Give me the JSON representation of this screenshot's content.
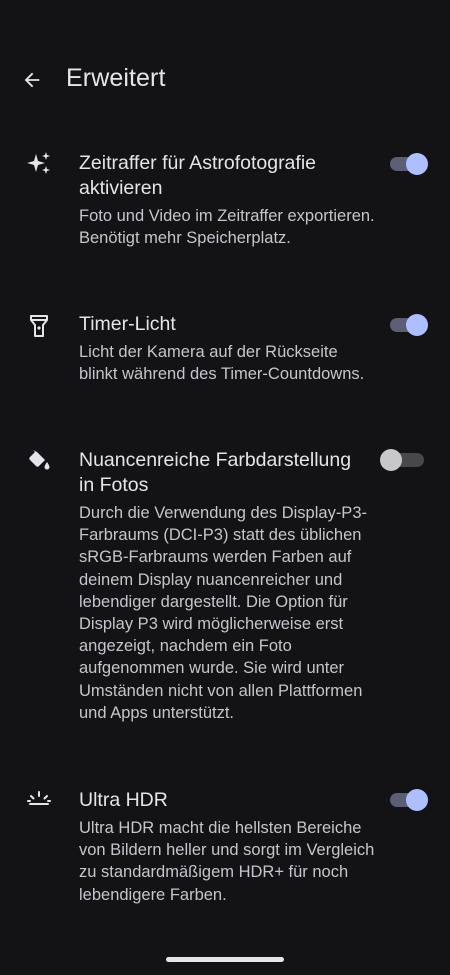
{
  "header": {
    "title": "Erweitert",
    "back_icon": "arrow-back-icon"
  },
  "settings": [
    {
      "icon": "sparkle-icon",
      "title": "Zeitraffer für Astrofotografie aktivieren",
      "description": "Foto und Video im Zeitraffer exportieren. Benötigt mehr Speicherplatz.",
      "enabled": true
    },
    {
      "icon": "flashlight-icon",
      "title": "Timer-Licht",
      "description": "Licht der Kamera auf der Rückseite blinkt während des Timer-Countdowns.",
      "enabled": true
    },
    {
      "icon": "paint-bucket-icon",
      "title": "Nuancenreiche Farbdarstellung in Fotos",
      "description": "Durch die Verwendung des Display-P3-Farbraums (DCI-P3) statt des üblichen sRGB-Farbraums werden Farben auf deinem Display nuancenreicher und lebendiger dargestellt. Die Option für Display P3 wird möglicherweise erst angezeigt, nachdem ein Foto aufgenommen wurde. Sie wird unter Umständen nicht von allen Plattformen und Apps unterstützt.",
      "enabled": false
    },
    {
      "icon": "hdr-sun-icon",
      "title": "Ultra HDR",
      "description": "Ultra HDR macht die hellsten Bereiche von Bildern heller und sorgt im Vergleich zu standardmäßigem HDR+ für noch lebendigere Farben.",
      "enabled": true
    }
  ],
  "colors": {
    "background": "#131316",
    "toggle_on_thumb": "#aebfff",
    "toggle_on_track": "#5b5e75",
    "toggle_off_thumb": "#c8c8cc",
    "toggle_off_track": "#48484c"
  }
}
